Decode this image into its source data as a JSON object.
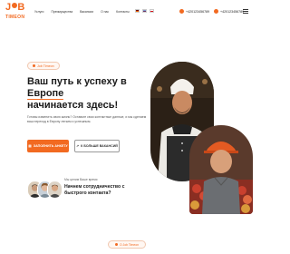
{
  "header": {
    "logo_top": "J",
    "logo_top_rest": "B",
    "logo_bottom": "TIMEON",
    "nav": [
      "Услуги",
      "Преимущества",
      "Вакансии",
      "О нас",
      "Контакты"
    ],
    "phone_1": "+420123456789",
    "phone_2": "+420123456789"
  },
  "hero": {
    "badge": "Job Timeon",
    "title_line1": "Ваш путь к успеху в",
    "title_highlight": "Европе",
    "title_line2": "начинается здесь!",
    "subtitle": "Готовы изменить свою жизнь? Оставьте свои контактные данные, и мы сделаем ваш переход в Европу легким и успешным.",
    "primary_button": "ЗАПОЛНИТЬ АНКЕТУ",
    "secondary_button": "К БОЛЬШЕ ВАКАНСИЙ"
  },
  "contact": {
    "lead": "Мы ценим Ваше время",
    "question": "Начнем сотрудничество с быстрого контакта?"
  },
  "bottom": {
    "pill": "О Job Timeon"
  },
  "colors": {
    "accent": "#f26a21",
    "text": "#1a1a1a"
  }
}
